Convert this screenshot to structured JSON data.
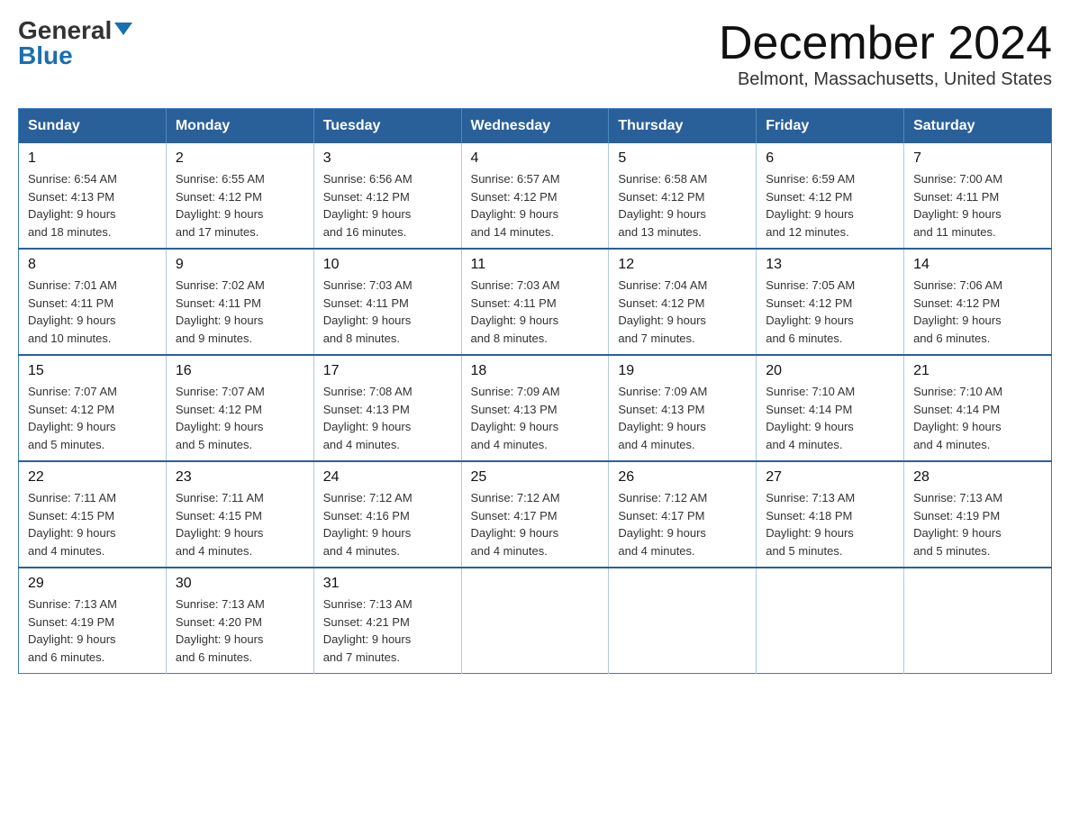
{
  "logo": {
    "general": "General",
    "blue": "Blue"
  },
  "title": {
    "month": "December 2024",
    "location": "Belmont, Massachusetts, United States"
  },
  "weekdays": [
    "Sunday",
    "Monday",
    "Tuesday",
    "Wednesday",
    "Thursday",
    "Friday",
    "Saturday"
  ],
  "weeks": [
    [
      {
        "day": "1",
        "sunrise": "6:54 AM",
        "sunset": "4:13 PM",
        "daylight": "9 hours and 18 minutes."
      },
      {
        "day": "2",
        "sunrise": "6:55 AM",
        "sunset": "4:12 PM",
        "daylight": "9 hours and 17 minutes."
      },
      {
        "day": "3",
        "sunrise": "6:56 AM",
        "sunset": "4:12 PM",
        "daylight": "9 hours and 16 minutes."
      },
      {
        "day": "4",
        "sunrise": "6:57 AM",
        "sunset": "4:12 PM",
        "daylight": "9 hours and 14 minutes."
      },
      {
        "day": "5",
        "sunrise": "6:58 AM",
        "sunset": "4:12 PM",
        "daylight": "9 hours and 13 minutes."
      },
      {
        "day": "6",
        "sunrise": "6:59 AM",
        "sunset": "4:12 PM",
        "daylight": "9 hours and 12 minutes."
      },
      {
        "day": "7",
        "sunrise": "7:00 AM",
        "sunset": "4:11 PM",
        "daylight": "9 hours and 11 minutes."
      }
    ],
    [
      {
        "day": "8",
        "sunrise": "7:01 AM",
        "sunset": "4:11 PM",
        "daylight": "9 hours and 10 minutes."
      },
      {
        "day": "9",
        "sunrise": "7:02 AM",
        "sunset": "4:11 PM",
        "daylight": "9 hours and 9 minutes."
      },
      {
        "day": "10",
        "sunrise": "7:03 AM",
        "sunset": "4:11 PM",
        "daylight": "9 hours and 8 minutes."
      },
      {
        "day": "11",
        "sunrise": "7:03 AM",
        "sunset": "4:11 PM",
        "daylight": "9 hours and 8 minutes."
      },
      {
        "day": "12",
        "sunrise": "7:04 AM",
        "sunset": "4:12 PM",
        "daylight": "9 hours and 7 minutes."
      },
      {
        "day": "13",
        "sunrise": "7:05 AM",
        "sunset": "4:12 PM",
        "daylight": "9 hours and 6 minutes."
      },
      {
        "day": "14",
        "sunrise": "7:06 AM",
        "sunset": "4:12 PM",
        "daylight": "9 hours and 6 minutes."
      }
    ],
    [
      {
        "day": "15",
        "sunrise": "7:07 AM",
        "sunset": "4:12 PM",
        "daylight": "9 hours and 5 minutes."
      },
      {
        "day": "16",
        "sunrise": "7:07 AM",
        "sunset": "4:12 PM",
        "daylight": "9 hours and 5 minutes."
      },
      {
        "day": "17",
        "sunrise": "7:08 AM",
        "sunset": "4:13 PM",
        "daylight": "9 hours and 4 minutes."
      },
      {
        "day": "18",
        "sunrise": "7:09 AM",
        "sunset": "4:13 PM",
        "daylight": "9 hours and 4 minutes."
      },
      {
        "day": "19",
        "sunrise": "7:09 AM",
        "sunset": "4:13 PM",
        "daylight": "9 hours and 4 minutes."
      },
      {
        "day": "20",
        "sunrise": "7:10 AM",
        "sunset": "4:14 PM",
        "daylight": "9 hours and 4 minutes."
      },
      {
        "day": "21",
        "sunrise": "7:10 AM",
        "sunset": "4:14 PM",
        "daylight": "9 hours and 4 minutes."
      }
    ],
    [
      {
        "day": "22",
        "sunrise": "7:11 AM",
        "sunset": "4:15 PM",
        "daylight": "9 hours and 4 minutes."
      },
      {
        "day": "23",
        "sunrise": "7:11 AM",
        "sunset": "4:15 PM",
        "daylight": "9 hours and 4 minutes."
      },
      {
        "day": "24",
        "sunrise": "7:12 AM",
        "sunset": "4:16 PM",
        "daylight": "9 hours and 4 minutes."
      },
      {
        "day": "25",
        "sunrise": "7:12 AM",
        "sunset": "4:17 PM",
        "daylight": "9 hours and 4 minutes."
      },
      {
        "day": "26",
        "sunrise": "7:12 AM",
        "sunset": "4:17 PM",
        "daylight": "9 hours and 4 minutes."
      },
      {
        "day": "27",
        "sunrise": "7:13 AM",
        "sunset": "4:18 PM",
        "daylight": "9 hours and 5 minutes."
      },
      {
        "day": "28",
        "sunrise": "7:13 AM",
        "sunset": "4:19 PM",
        "daylight": "9 hours and 5 minutes."
      }
    ],
    [
      {
        "day": "29",
        "sunrise": "7:13 AM",
        "sunset": "4:19 PM",
        "daylight": "9 hours and 6 minutes."
      },
      {
        "day": "30",
        "sunrise": "7:13 AM",
        "sunset": "4:20 PM",
        "daylight": "9 hours and 6 minutes."
      },
      {
        "day": "31",
        "sunrise": "7:13 AM",
        "sunset": "4:21 PM",
        "daylight": "9 hours and 7 minutes."
      },
      null,
      null,
      null,
      null
    ]
  ],
  "labels": {
    "sunrise": "Sunrise: ",
    "sunset": "Sunset: ",
    "daylight": "Daylight: "
  }
}
